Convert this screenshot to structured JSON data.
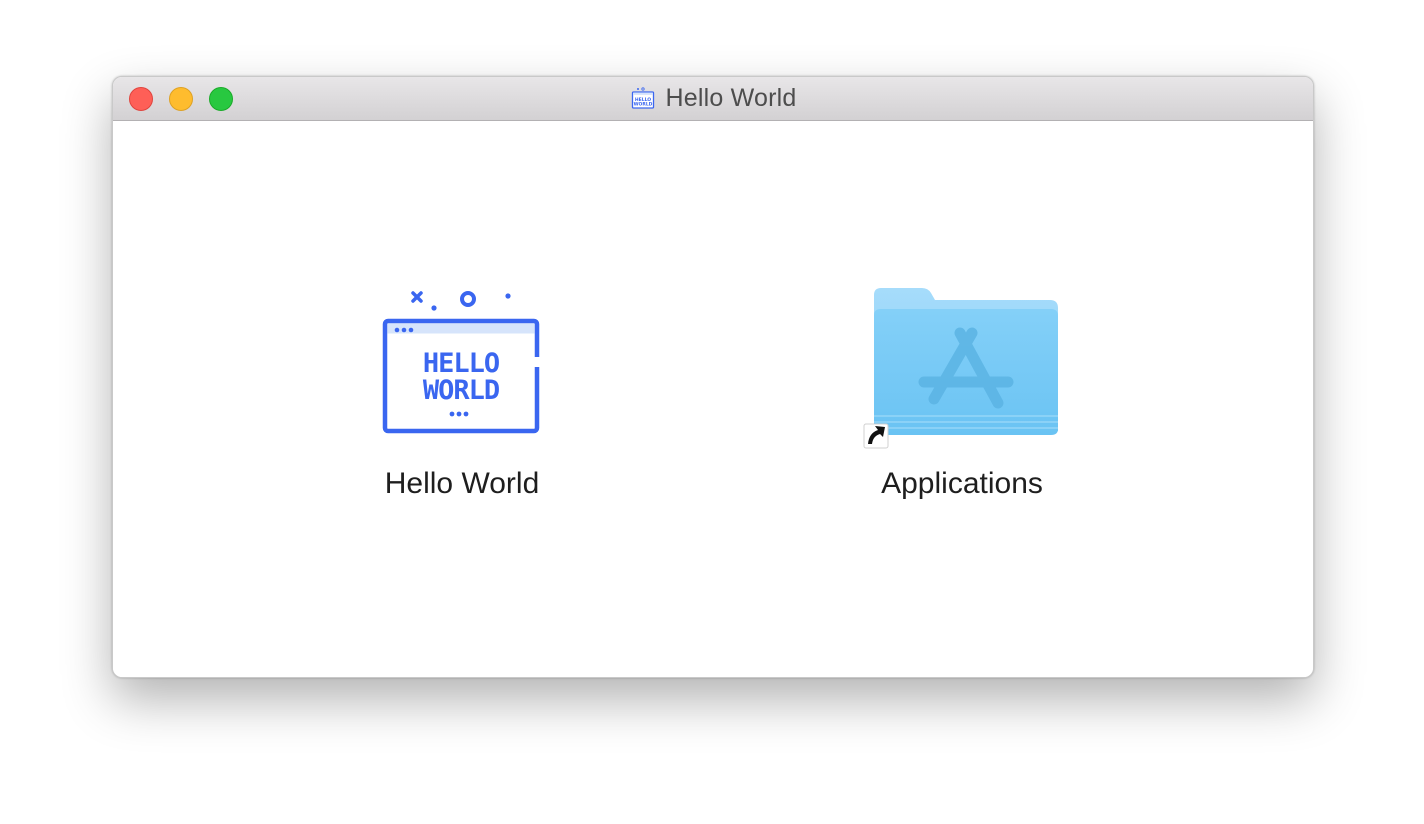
{
  "window": {
    "title": "Hello World",
    "title_icon": "hello-world-app-icon"
  },
  "traffic_lights": [
    {
      "name": "close",
      "color": "#fe5f57"
    },
    {
      "name": "minimize",
      "color": "#febc2e"
    },
    {
      "name": "zoom",
      "color": "#28c840"
    }
  ],
  "items": {
    "app": {
      "label": "Hello World",
      "icon": "hello-world-app-icon",
      "icon_text_line1": "HELLO",
      "icon_text_line2": "WORLD",
      "accent_color": "#3a66f0"
    },
    "applications": {
      "label": "Applications",
      "icon": "applications-folder-alias-icon",
      "folder_color": "#6fc9f6"
    }
  }
}
